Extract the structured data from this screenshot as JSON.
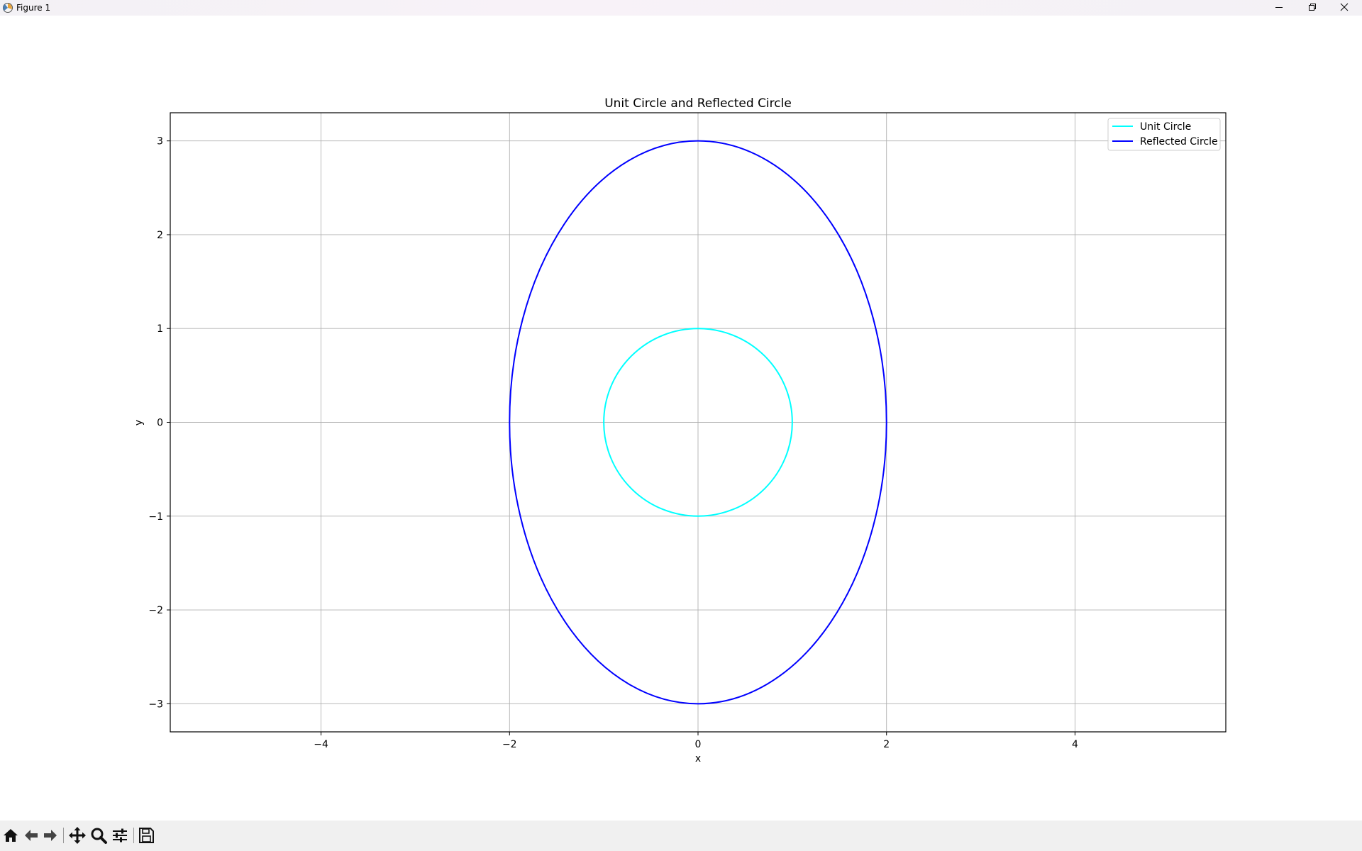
{
  "window": {
    "title": "Figure 1"
  },
  "toolbar": {
    "buttons": [
      {
        "name": "home-button",
        "icon": "home-icon"
      },
      {
        "name": "back-button",
        "icon": "arrow-left-icon"
      },
      {
        "name": "forward-button",
        "icon": "arrow-right-icon"
      },
      {
        "name": "pan-button",
        "icon": "move-icon"
      },
      {
        "name": "zoom-button",
        "icon": "magnifier-icon"
      },
      {
        "name": "configure-button",
        "icon": "sliders-icon"
      },
      {
        "name": "save-button",
        "icon": "floppy-disk-icon"
      }
    ]
  },
  "chart_data": {
    "type": "line",
    "title": "Unit Circle and Reflected Circle",
    "xlabel": "x",
    "ylabel": "y",
    "xlim": [
      -5.6,
      5.6
    ],
    "ylim": [
      -3.3,
      3.3
    ],
    "xticks": [
      -4,
      -2,
      0,
      2,
      4
    ],
    "yticks": [
      -3,
      -2,
      -1,
      0,
      1,
      2,
      3
    ],
    "xtick_labels": [
      "−4",
      "−2",
      "0",
      "2",
      "4"
    ],
    "ytick_labels": [
      "−3",
      "−2",
      "−1",
      "0",
      "1",
      "2",
      "3"
    ],
    "grid": true,
    "legend_position": "top-right",
    "series": [
      {
        "name": "Unit Circle",
        "color": "#00ffff",
        "shape": "ellipse",
        "center": [
          0,
          0
        ],
        "rx": 1,
        "ry": 1
      },
      {
        "name": "Reflected Circle",
        "color": "#0000ff",
        "shape": "ellipse",
        "center": [
          0,
          0
        ],
        "rx": 2,
        "ry": 3
      }
    ]
  }
}
